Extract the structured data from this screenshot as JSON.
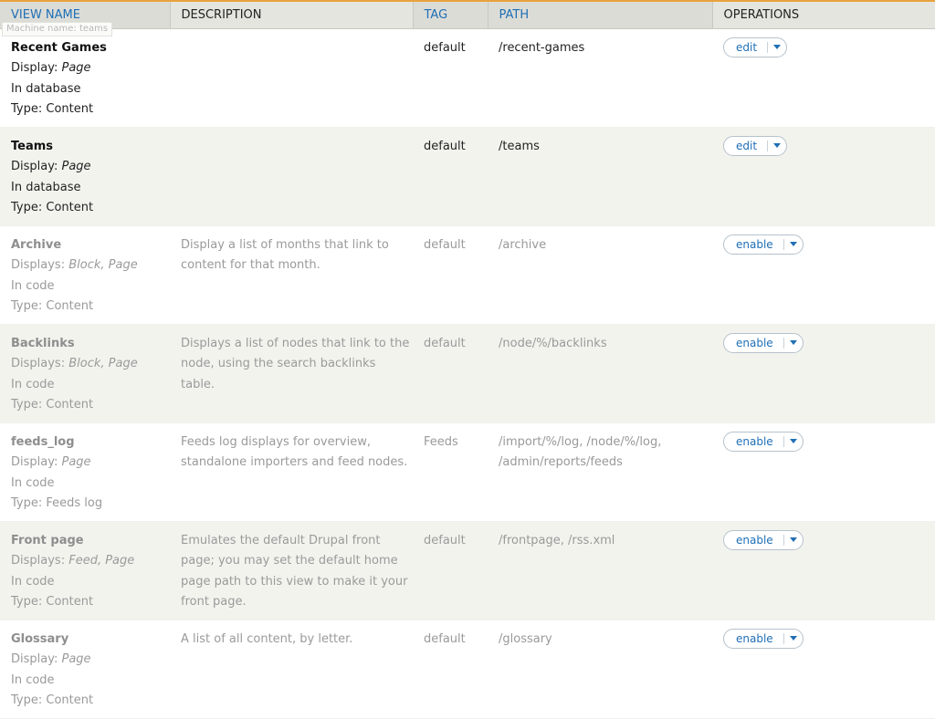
{
  "tooltip": "Machine name: teams",
  "headers": {
    "view_name": "VIEW NAME",
    "description": "DESCRIPTION",
    "tag": "TAG",
    "path": "PATH",
    "operations": "OPERATIONS"
  },
  "rows": [
    {
      "name": "Recent Games",
      "display_prefix": "Display: ",
      "display": "Page",
      "storage": "In database",
      "type": "Type: Content",
      "description": "",
      "tag": "default",
      "path": "/recent-games",
      "op": "edit"
    },
    {
      "name": "Teams",
      "display_prefix": "Display: ",
      "display": "Page",
      "storage": "In database",
      "type": "Type: Content",
      "description": "",
      "tag": "default",
      "path": "/teams",
      "op": "edit"
    },
    {
      "name": "Archive",
      "display_prefix": "Displays: ",
      "display": "Block, Page",
      "storage": "In code",
      "type": "Type: Content",
      "description": "Display a list of months that link to content for that month.",
      "tag": "default",
      "path": "/archive",
      "op": "enable"
    },
    {
      "name": "Backlinks",
      "display_prefix": "Displays: ",
      "display": "Block, Page",
      "storage": "In code",
      "type": "Type: Content",
      "description": "Displays a list of nodes that link to the node, using the search backlinks table.",
      "tag": "default",
      "path": "/node/%/backlinks",
      "op": "enable"
    },
    {
      "name": "feeds_log",
      "display_prefix": "Display: ",
      "display": "Page",
      "storage": "In code",
      "type": "Type: Feeds log",
      "description": "Feeds log displays for overview, standalone importers and feed nodes.",
      "tag": "Feeds",
      "path": "/import/%/log, /node/%/log, /admin/reports/feeds",
      "op": "enable"
    },
    {
      "name": "Front page",
      "display_prefix": "Displays: ",
      "display": "Feed, Page",
      "storage": "In code",
      "type": "Type: Content",
      "description": "Emulates the default Drupal front page; you may set the default home page path to this view to make it your front page.",
      "tag": "default",
      "path": "/frontpage, /rss.xml",
      "op": "enable"
    },
    {
      "name": "Glossary",
      "display_prefix": "Display: ",
      "display": "Page",
      "storage": "In code",
      "type": "Type: Content",
      "description": "A list of all content, by letter.",
      "tag": "default",
      "path": "/glossary",
      "op": "enable"
    }
  ],
  "colors": {
    "accent": "#1f6fb5",
    "header_bg": "#e5e5e0",
    "stripe": "#f3f3ee",
    "border_top": "#e8a33d"
  },
  "icons": {
    "op_dropdown": "caret-down-icon"
  }
}
